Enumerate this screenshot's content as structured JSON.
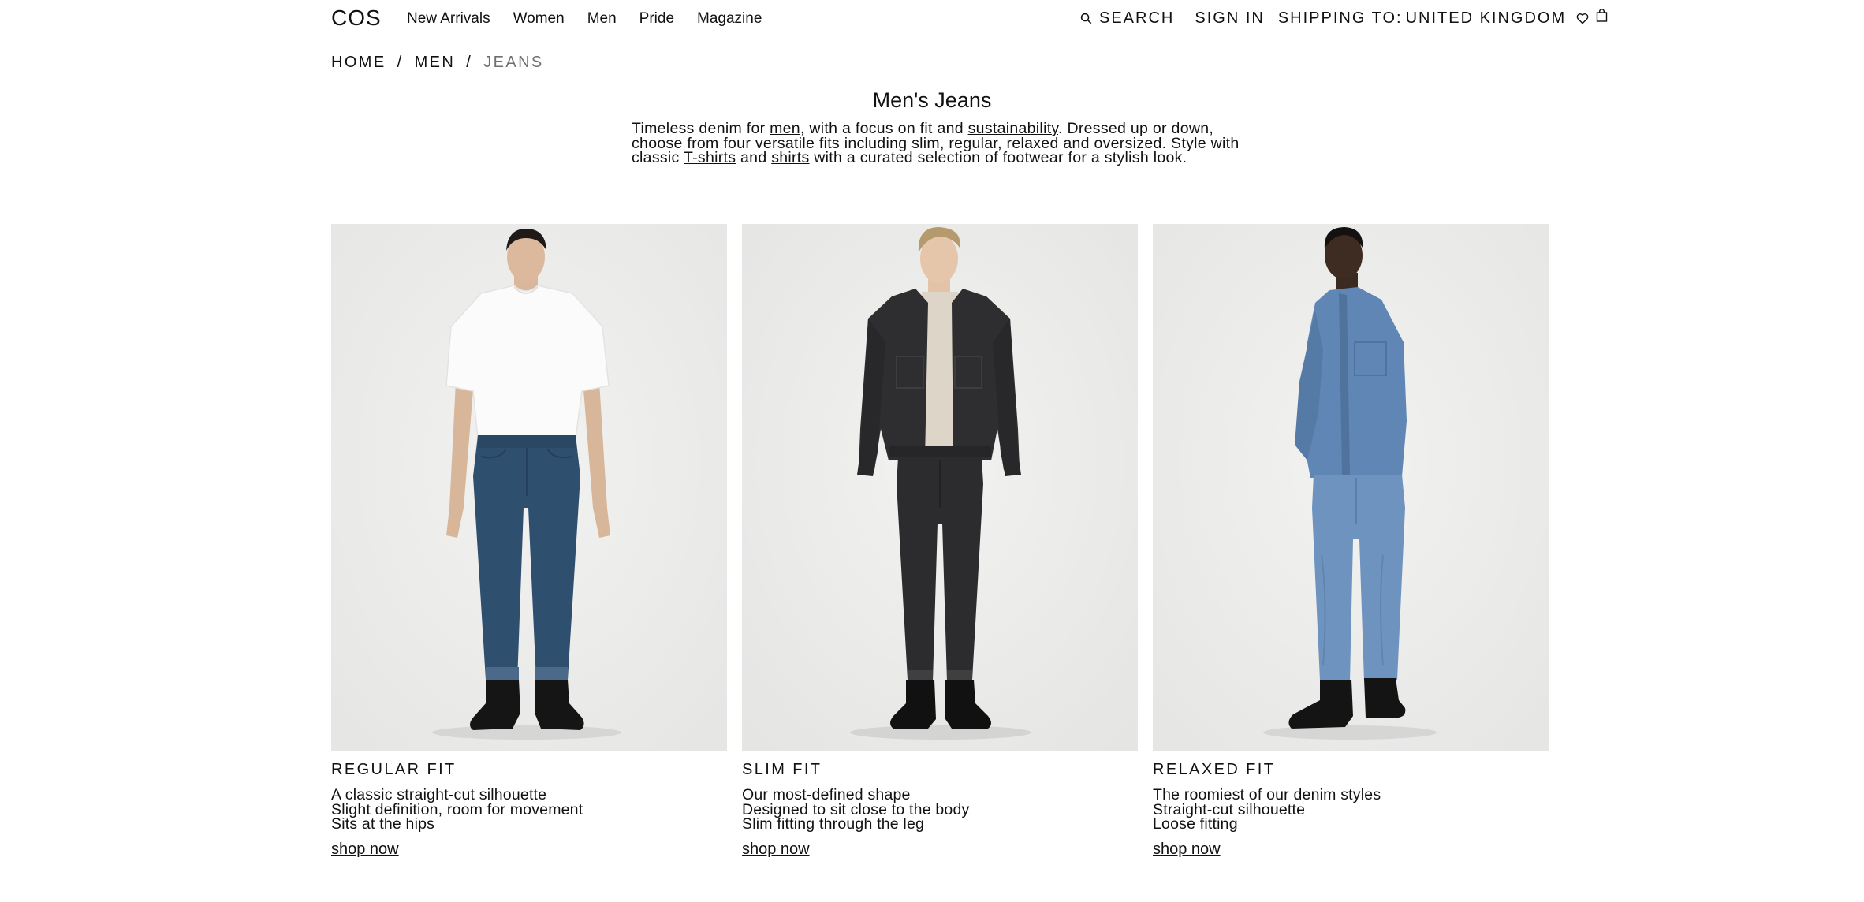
{
  "header": {
    "logo": "COS",
    "nav": [
      "New Arrivals",
      "Women",
      "Men",
      "Pride",
      "Magazine"
    ],
    "search_label": "SEARCH",
    "signin_label": "SIGN IN",
    "shipping_label": "SHIPPING TO:",
    "shipping_country": "UNITED KINGDOM"
  },
  "breadcrumb": [
    "HOME",
    "MEN",
    "JEANS"
  ],
  "breadcrumb_separator": "/",
  "page_title": "Men's Jeans",
  "intro": {
    "t1": "Timeless denim for ",
    "link_men": "men",
    "t2": ", with a focus on fit and ",
    "link_sustainability": "sustainability",
    "t3": ". Dressed up or down, choose from four versatile fits including slim, regular, relaxed and oversized. Style with classic ",
    "link_tshirts": "T-shirts",
    "t4": " and ",
    "link_shirts": "shirts",
    "t5": " with a curated selection of footwear for a stylish look."
  },
  "products": [
    {
      "title": "REGULAR FIT",
      "lines": [
        "A classic straight-cut silhouette",
        "Slight definition, room for movement",
        "Sits at the hips"
      ],
      "cta": "shop now"
    },
    {
      "title": "SLIM FIT",
      "lines": [
        "Our most-defined shape",
        "Designed to sit close to the body",
        "Slim fitting through the leg"
      ],
      "cta": "shop now"
    },
    {
      "title": "RELAXED FIT",
      "lines": [
        "The roomiest of our denim styles",
        "Straight-cut silhouette",
        "Loose fitting"
      ],
      "cta": "shop now"
    }
  ],
  "icons": {
    "search": "search-icon",
    "wishlist": "heart-icon",
    "bag": "shopping-bag-icon"
  },
  "colors": {
    "text": "#111111",
    "muted": "#6f6f6f",
    "image_bg": "#ececeb",
    "denim_regular": "#2f4f6e",
    "denim_slim": "#2c2c2e",
    "denim_relaxed": "#5f86b4"
  }
}
